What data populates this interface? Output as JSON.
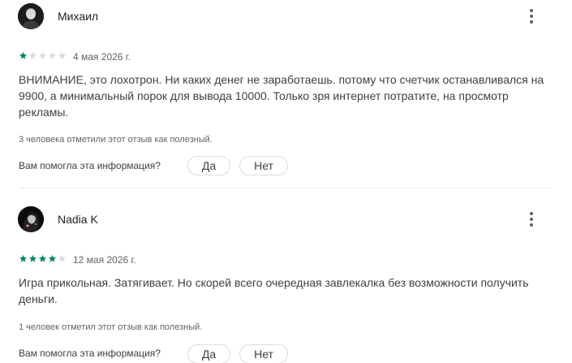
{
  "reviews": [
    {
      "author": "Михаил",
      "rating": 1,
      "max_rating": 5,
      "date": "4 мая 2026 г.",
      "text": "ВНИМАНИЕ, это лохотрон. Ни каких денег не заработаешь. потому что счетчик останавливался на 9900, а минимальный порок для вывода 10000. Только зря интернет потратите, на просмотр рекламы.",
      "helpful_text": "3 человека отметили этот отзыв как полезный.",
      "question": "Вам помогла эта информация?",
      "yes_label": "Да",
      "no_label": "Нет"
    },
    {
      "author": "Nadia K",
      "rating": 4,
      "max_rating": 5,
      "date": "12 мая 2026 г.",
      "text": "Игра прикольная. Затягивает. Но скорей всего очередная завлекалка без возможности получить деньги.",
      "helpful_text": "1 человек отметил этот отзыв как полезный.",
      "question": "Вам помогла эта информация?",
      "yes_label": "Да",
      "no_label": "Нет"
    }
  ],
  "colors": {
    "star_filled": "#01875f",
    "star_empty": "#dadce0",
    "divider": "#e8eaed"
  },
  "icons": {
    "more": "more-vert-icon",
    "star": "star-icon"
  }
}
